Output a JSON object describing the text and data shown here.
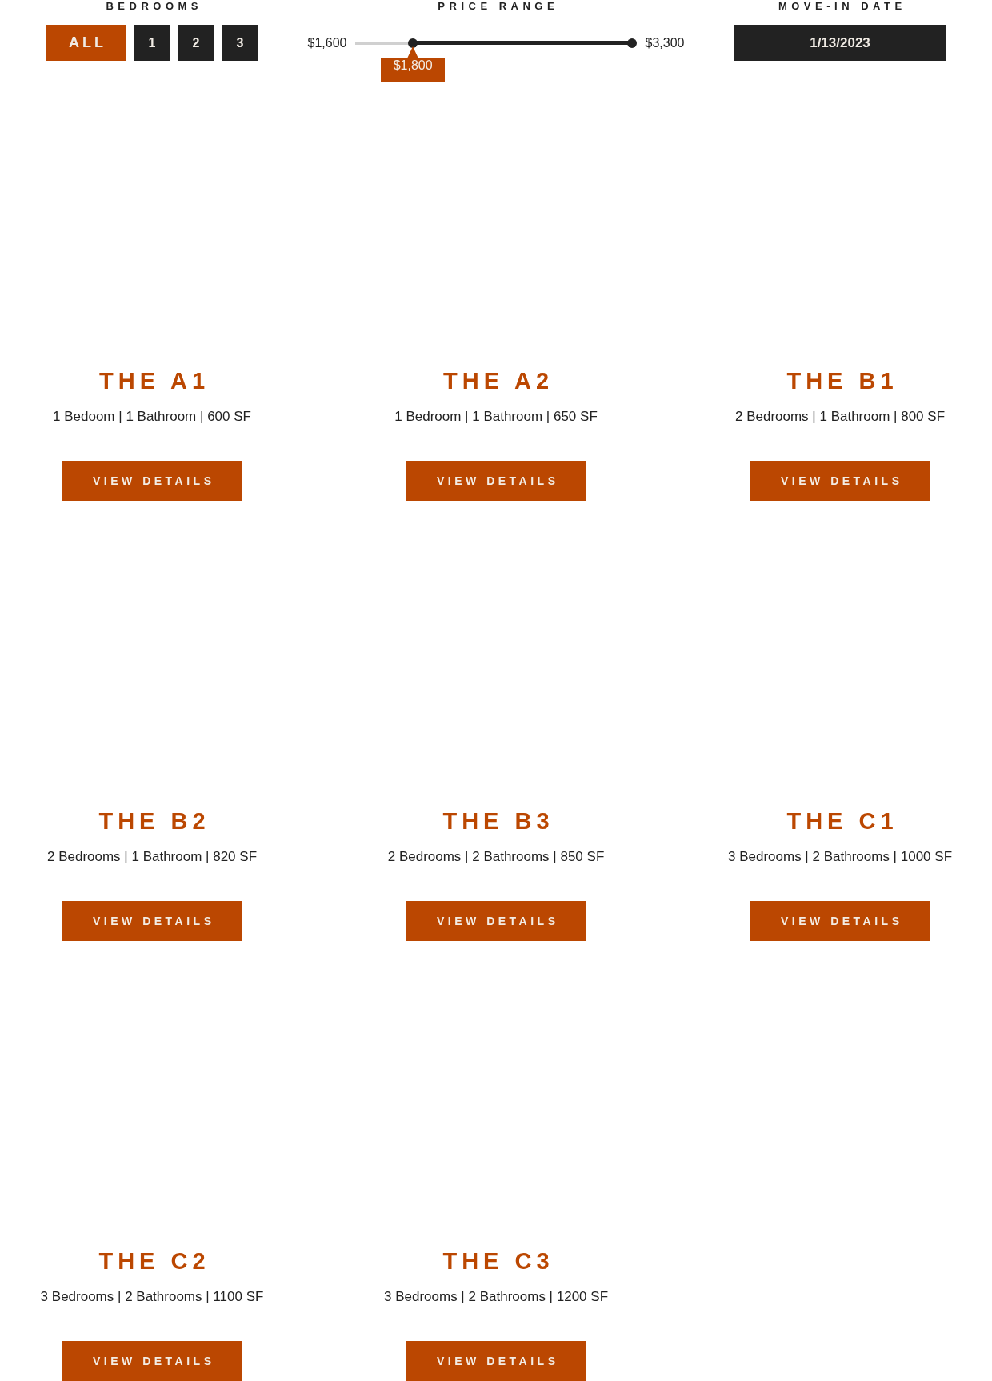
{
  "filters": {
    "bedrooms": {
      "label": "BEDROOMS",
      "options": [
        {
          "label": "ALL",
          "kind": "all",
          "selected": true
        },
        {
          "label": "1",
          "kind": "count",
          "selected": false
        },
        {
          "label": "2",
          "kind": "count",
          "selected": false
        },
        {
          "label": "3",
          "kind": "count",
          "selected": false
        }
      ]
    },
    "price_range": {
      "label": "PRICE RANGE",
      "min_label": "$1,600",
      "max_label": "$3,300",
      "thumbs": [
        {
          "level": 0.21,
          "tooltip": "$1,800"
        },
        {
          "level": 1
        }
      ]
    },
    "move_in_date": {
      "label": "MOVE-IN DATE",
      "value": "1/13/2023"
    }
  },
  "floor_plans": [
    {
      "title": "THE A1",
      "specs": "1 Bedoom | 1 Bathroom | 600 SF",
      "button": "VIEW DETAILS"
    },
    {
      "title": "THE A2",
      "specs": "1 Bedroom | 1 Bathroom | 650 SF",
      "button": "VIEW DETAILS"
    },
    {
      "title": "THE B1",
      "specs": "2 Bedrooms | 1 Bathroom | 800 SF",
      "button": "VIEW DETAILS"
    },
    {
      "title": "THE B2",
      "specs": "2 Bedrooms | 1 Bathroom | 820 SF",
      "button": "VIEW DETAILS"
    },
    {
      "title": "THE B3",
      "specs": "2 Bedrooms | 2 Bathrooms | 850 SF",
      "button": "VIEW DETAILS"
    },
    {
      "title": "THE C1",
      "specs": "3 Bedrooms | 2 Bathrooms | 1000 SF",
      "button": "VIEW DETAILS"
    },
    {
      "title": "THE C2",
      "specs": "3 Bedrooms | 2 Bathrooms | 1100 SF",
      "button": "VIEW DETAILS"
    },
    {
      "title": "THE C3",
      "specs": "3 Bedrooms | 2 Bathrooms | 1200 SF",
      "button": "VIEW DETAILS"
    }
  ]
}
